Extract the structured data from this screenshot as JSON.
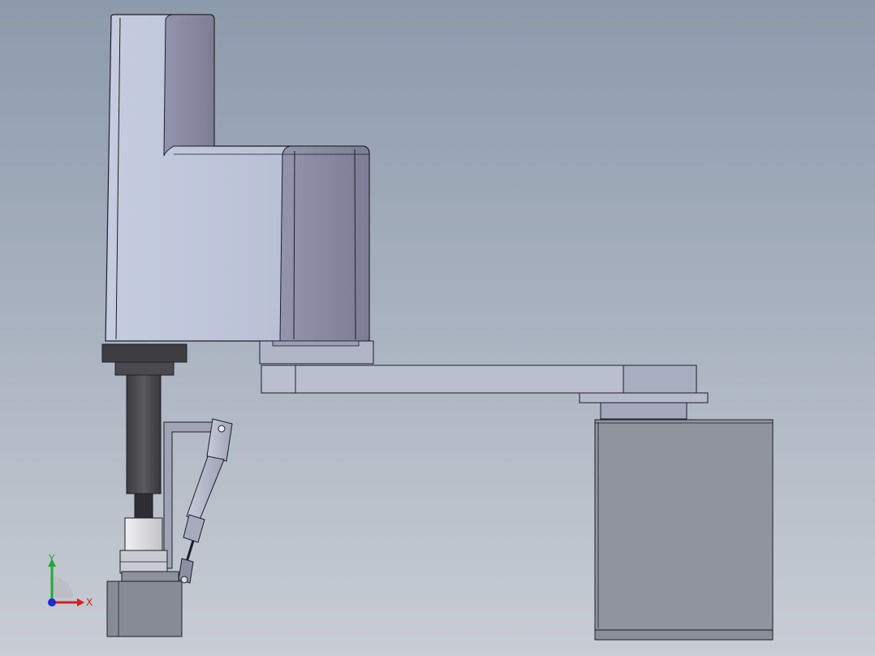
{
  "viewport": {
    "background_top": "#8c9aab",
    "background_bottom": "#c8cdd4"
  },
  "model": {
    "colors": {
      "body_light": "#bcc4d8",
      "body_dark": "#8a8aa2",
      "body_mid": "#a4aac0",
      "edge": "#1e1e26",
      "dark_metal": "#4a4a4e",
      "darker_metal": "#333338",
      "base_box": "#8e939d",
      "arm": "#b6bccc",
      "cylinder": "#a8adbf",
      "gripper_white": "#dadade"
    }
  },
  "triad": {
    "x_label": "X",
    "y_label": "Y",
    "x_color": "#d81e1e",
    "y_color": "#22a83a",
    "z_color": "#1e2ad6"
  }
}
